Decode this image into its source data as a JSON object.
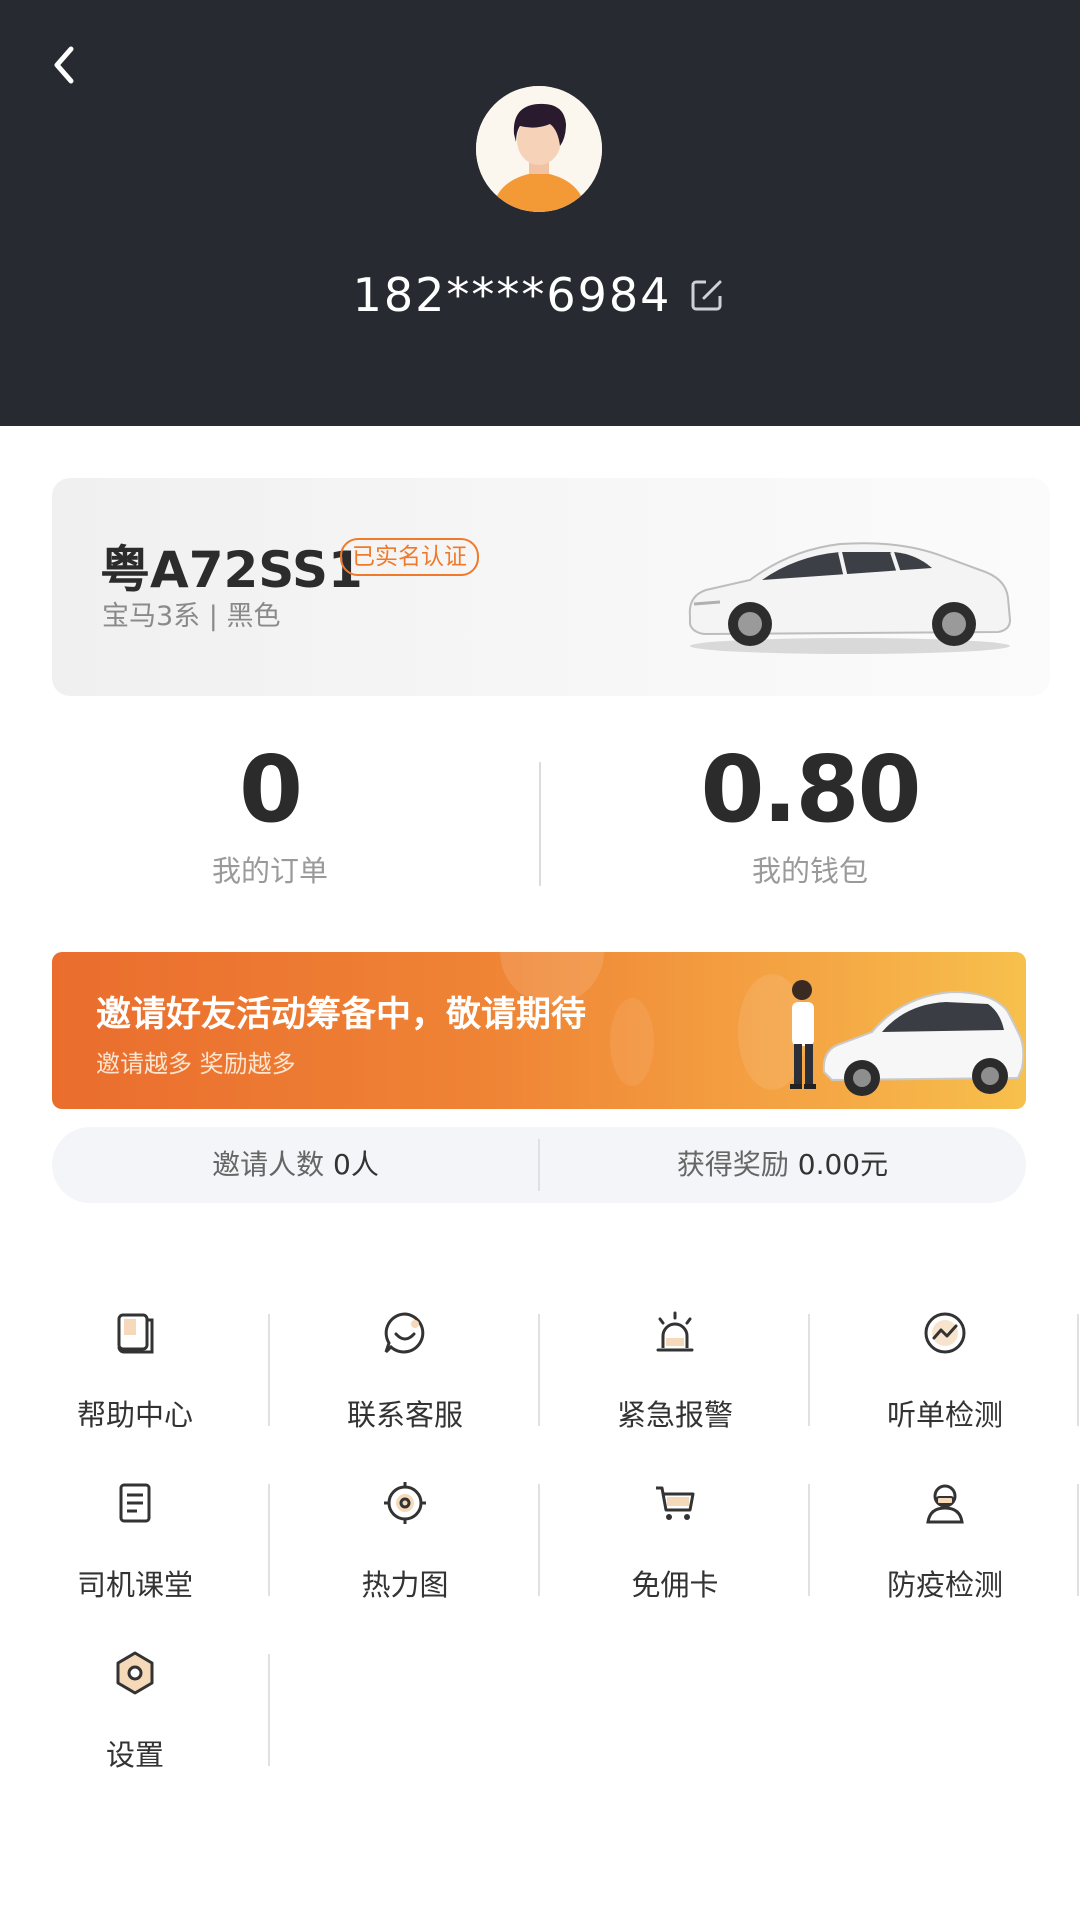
{
  "header": {
    "phone": "182****6984"
  },
  "vehicle": {
    "plate": "粤A72SS1",
    "badge": "已实名认证",
    "description": "宝马3系 | 黑色"
  },
  "stats": [
    {
      "value": "0",
      "label": "我的订单"
    },
    {
      "value": "0.80",
      "label": "我的钱包"
    }
  ],
  "banner": {
    "title": "邀请好友活动筹备中，敬请期待",
    "subtitle": "邀请越多 奖励越多"
  },
  "invite": {
    "count_label": "邀请人数",
    "count_value": "0人",
    "reward_label": "获得奖励",
    "reward_value": "0.00元"
  },
  "menu": [
    {
      "label": "帮助中心",
      "icon": "book-icon"
    },
    {
      "label": "联系客服",
      "icon": "chat-bubble-icon"
    },
    {
      "label": "紧急报警",
      "icon": "alarm-light-icon"
    },
    {
      "label": "听单检测",
      "icon": "pulse-icon"
    },
    {
      "label": "司机课堂",
      "icon": "document-icon"
    },
    {
      "label": "热力图",
      "icon": "target-icon"
    },
    {
      "label": "免佣卡",
      "icon": "cart-icon"
    },
    {
      "label": "防疫检测",
      "icon": "masked-person-icon"
    },
    {
      "label": "设置",
      "icon": "hex-gear-icon"
    }
  ],
  "colors": {
    "header_bg": "#272a31",
    "accent": "#f07a2a"
  }
}
